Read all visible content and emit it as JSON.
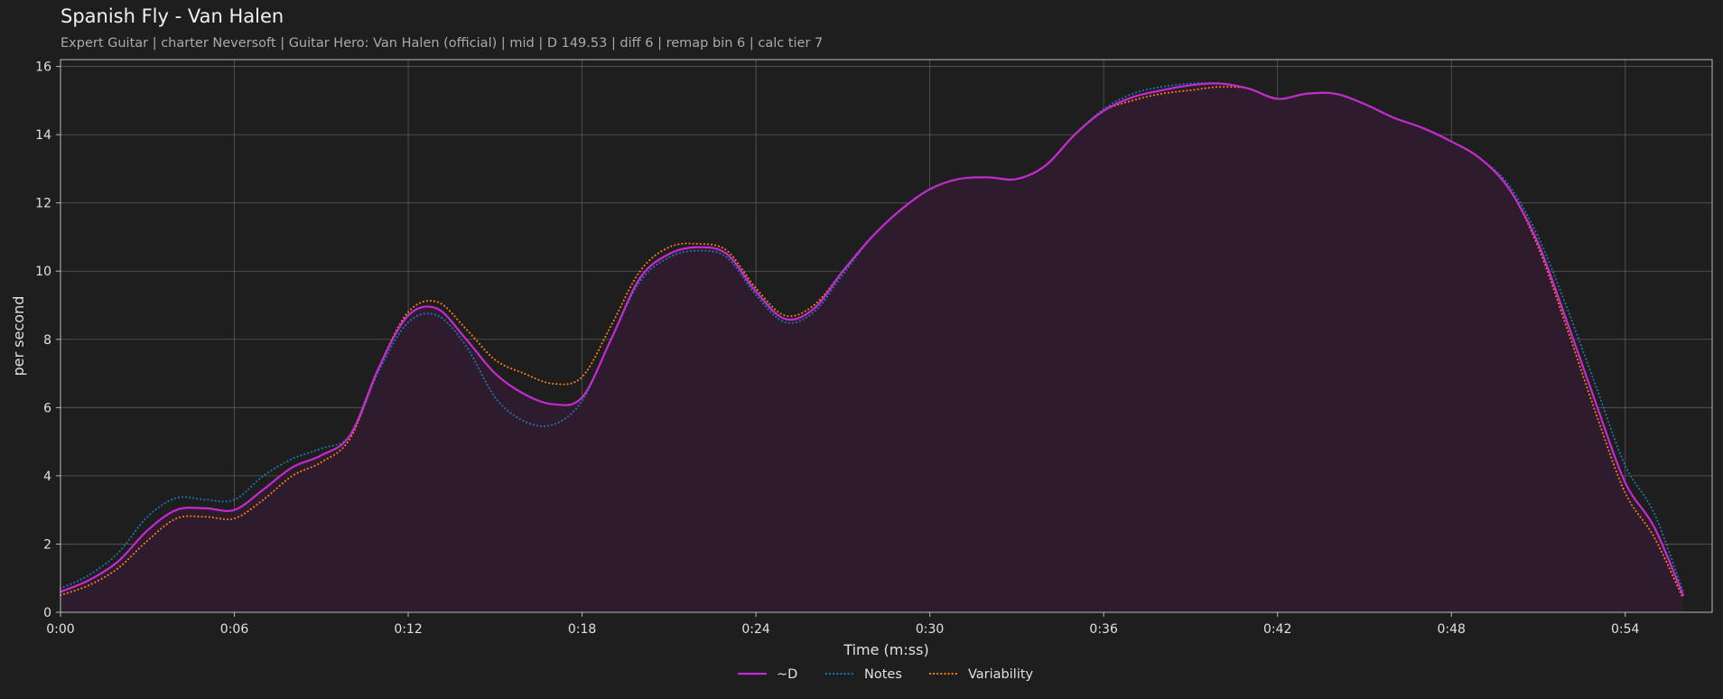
{
  "header": {
    "title": "Spanish Fly - Van Halen",
    "subtitle": "Expert Guitar  |  charter Neversoft  |  Guitar Hero: Van Halen (official)  |  mid  |  D 149.53  |  diff 6  |  remap bin 6  |  calc tier 7"
  },
  "colors": {
    "background": "#1e1e1e",
    "plot_background": "#1e1e1e",
    "grid": "#5a5a5a",
    "fill": "#2e1c2e",
    "d_line": "#c52ad0",
    "notes_line": "#1f77b4",
    "variability_line": "#ff7f0e"
  },
  "chart_data": {
    "type": "line",
    "title": "Spanish Fly - Van Halen",
    "xlabel": "Time (m:ss)",
    "ylabel": "per second",
    "xlim": [
      0,
      57
    ],
    "ylim": [
      0,
      16.2
    ],
    "grid": true,
    "legend_position": "bottom-center",
    "x_ticks": [
      0,
      6,
      12,
      18,
      24,
      30,
      36,
      42,
      48,
      54
    ],
    "x_tick_labels": [
      "0:00",
      "0:06",
      "0:12",
      "0:18",
      "0:24",
      "0:30",
      "0:36",
      "0:42",
      "0:48",
      "0:54"
    ],
    "y_ticks": [
      0,
      2,
      4,
      6,
      8,
      10,
      12,
      14,
      16
    ],
    "y_tick_labels": [
      "0",
      "2",
      "4",
      "6",
      "8",
      "10",
      "12",
      "14",
      "16"
    ],
    "x": [
      0,
      1,
      2,
      3,
      4,
      5,
      6,
      7,
      8,
      9,
      10,
      11,
      12,
      13,
      14,
      15,
      16,
      17,
      18,
      19,
      20,
      21,
      22,
      23,
      24,
      25,
      26,
      27,
      28,
      29,
      30,
      31,
      32,
      33,
      34,
      35,
      36,
      37,
      38,
      39,
      40,
      41,
      42,
      43,
      44,
      45,
      46,
      47,
      48,
      49,
      50,
      51,
      52,
      53,
      54,
      55,
      56,
      57
    ],
    "series": [
      {
        "name": "~D",
        "style": "solid",
        "fill": true,
        "values": [
          0.6,
          0.95,
          1.5,
          2.4,
          3.0,
          3.05,
          3.0,
          3.6,
          4.25,
          4.6,
          5.2,
          7.2,
          8.7,
          8.9,
          8.0,
          7.0,
          6.4,
          6.1,
          6.3,
          8.0,
          9.8,
          10.5,
          10.7,
          10.5,
          9.4,
          8.6,
          8.9,
          10.0,
          11.0,
          11.8,
          12.4,
          12.7,
          12.75,
          12.7,
          13.1,
          14.0,
          14.7,
          15.1,
          15.3,
          15.45,
          15.5,
          15.35,
          15.05,
          15.2,
          15.2,
          14.9,
          14.5,
          14.2,
          13.8,
          13.3,
          12.4,
          10.8,
          8.5,
          6.1,
          3.8,
          2.5,
          0.5
        ],
        "value_extra": []
      },
      {
        "name": "Notes",
        "style": "dotted",
        "fill": false,
        "values": [
          0.7,
          1.1,
          1.75,
          2.8,
          3.35,
          3.3,
          3.3,
          4.0,
          4.5,
          4.8,
          5.2,
          7.1,
          8.5,
          8.7,
          7.8,
          6.3,
          5.6,
          5.5,
          6.2,
          8.0,
          9.7,
          10.4,
          10.6,
          10.4,
          9.3,
          8.5,
          8.8,
          9.9,
          11.0,
          11.8,
          12.4,
          12.7,
          12.75,
          12.7,
          13.1,
          14.0,
          14.75,
          15.2,
          15.4,
          15.5,
          15.5,
          15.35,
          15.05,
          15.2,
          15.2,
          14.9,
          14.5,
          14.2,
          13.8,
          13.3,
          12.5,
          11.0,
          8.9,
          6.6,
          4.3,
          2.9,
          0.6
        ],
        "value_extra": []
      },
      {
        "name": "Variability",
        "style": "dotted",
        "fill": false,
        "values": [
          0.5,
          0.8,
          1.3,
          2.1,
          2.75,
          2.8,
          2.75,
          3.3,
          4.0,
          4.4,
          5.1,
          7.2,
          8.8,
          9.1,
          8.3,
          7.4,
          7.0,
          6.7,
          6.9,
          8.4,
          10.0,
          10.7,
          10.8,
          10.6,
          9.5,
          8.7,
          9.0,
          10.0,
          11.0,
          11.8,
          12.4,
          12.7,
          12.75,
          12.7,
          13.1,
          14.0,
          14.7,
          15.0,
          15.2,
          15.3,
          15.4,
          15.35,
          15.05,
          15.2,
          15.2,
          14.9,
          14.5,
          14.2,
          13.8,
          13.3,
          12.4,
          10.7,
          8.3,
          5.8,
          3.5,
          2.2,
          0.4
        ],
        "value_extra": []
      }
    ]
  }
}
